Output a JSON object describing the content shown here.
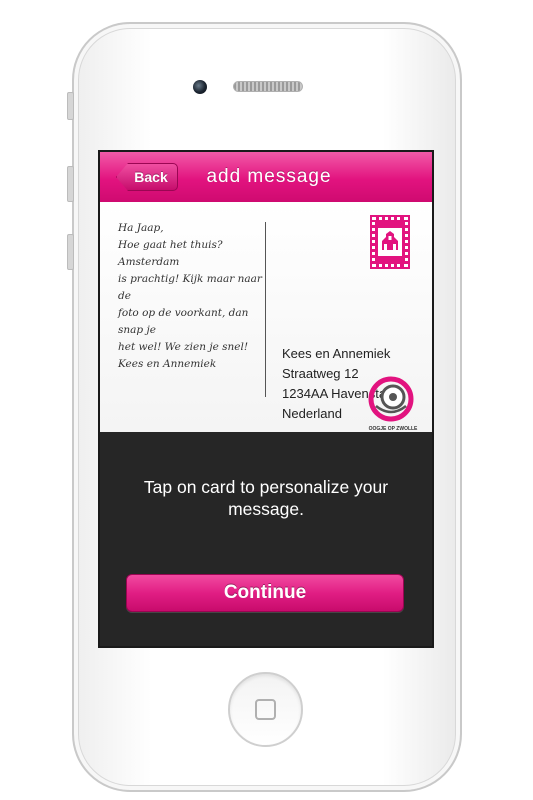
{
  "navbar": {
    "back_label": "Back",
    "title": "add message"
  },
  "card": {
    "message_lines": [
      "Ha Jaap,",
      "",
      "Hoe gaat het thuis? Amsterdam",
      "is prachtig! Kijk maar naar de",
      "foto op de voorkant, dan snap je",
      "het wel! We zien je snel!",
      "",
      "Kees en Annemiek"
    ],
    "address": [
      "Kees en Annemiek",
      "Straatweg 12",
      "1234AA Havenstad",
      "Nederland"
    ],
    "logo_text": "OOGJE OP ZWOLLE"
  },
  "instruction": "Tap on card to personalize your message.",
  "continue_label": "Continue",
  "colors": {
    "accent": "#e2137f",
    "screen_background": "#262626"
  },
  "icons": {
    "stamp": "stamp-icon",
    "logo": "eye-logo-icon",
    "home": "home-button-icon"
  }
}
